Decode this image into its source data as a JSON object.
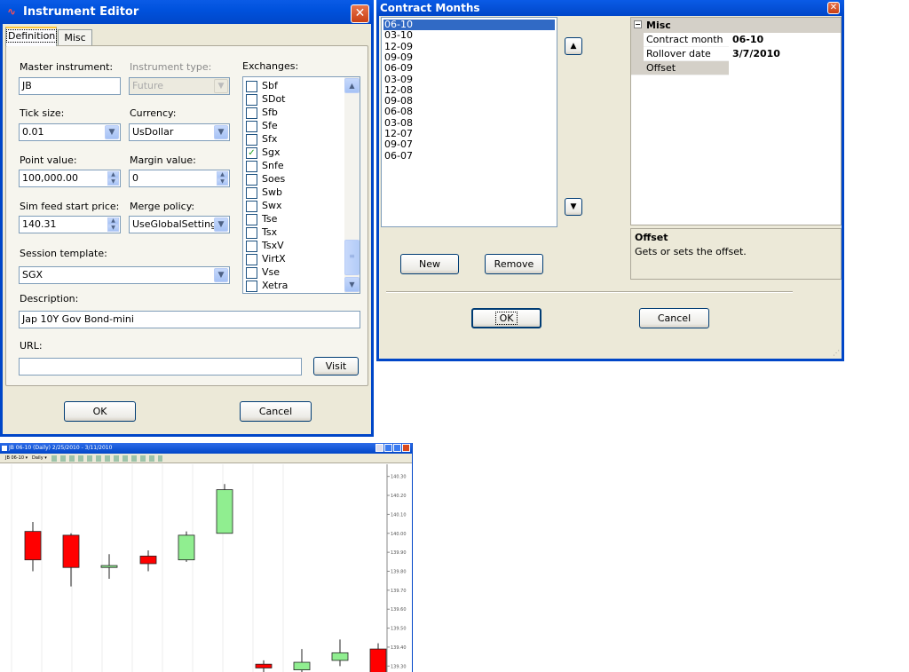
{
  "instrument_editor": {
    "title": "Instrument Editor",
    "tabs": [
      "Definition",
      "Misc"
    ],
    "master_instrument": {
      "label": "Master instrument:",
      "value": "JB"
    },
    "instrument_type": {
      "label": "Instrument type:",
      "value": "Future"
    },
    "exchanges_label": "Exchanges:",
    "tick_size": {
      "label": "Tick size:",
      "value": "0.01"
    },
    "currency": {
      "label": "Currency:",
      "value": "UsDollar"
    },
    "point_value": {
      "label": "Point value:",
      "value": "100,000.00"
    },
    "margin_value": {
      "label": "Margin value:",
      "value": "0"
    },
    "sim_feed_start_price": {
      "label": "Sim feed start price:",
      "value": "140.31"
    },
    "merge_policy": {
      "label": "Merge policy:",
      "value": "UseGlobalSettings"
    },
    "session_template": {
      "label": "Session template:",
      "value": "SGX"
    },
    "description": {
      "label": "Description:",
      "value": "Jap 10Y Gov Bond-mini"
    },
    "url": {
      "label": "URL:",
      "value": ""
    },
    "visit_label": "Visit",
    "ok_label": "OK",
    "cancel_label": "Cancel",
    "exchanges": [
      {
        "name": "Sbf",
        "checked": false
      },
      {
        "name": "SDot",
        "checked": false
      },
      {
        "name": "Sfb",
        "checked": false
      },
      {
        "name": "Sfe",
        "checked": false
      },
      {
        "name": "Sfx",
        "checked": false
      },
      {
        "name": "Sgx",
        "checked": true
      },
      {
        "name": "Snfe",
        "checked": false
      },
      {
        "name": "Soes",
        "checked": false
      },
      {
        "name": "Swb",
        "checked": false
      },
      {
        "name": "Swx",
        "checked": false
      },
      {
        "name": "Tse",
        "checked": false
      },
      {
        "name": "Tsx",
        "checked": false
      },
      {
        "name": "TsxV",
        "checked": false
      },
      {
        "name": "VirtX",
        "checked": false
      },
      {
        "name": "Vse",
        "checked": false
      },
      {
        "name": "Xetra",
        "checked": false
      }
    ]
  },
  "contract_months": {
    "title": "Contract Months",
    "months": [
      "06-10",
      "03-10",
      "12-09",
      "09-09",
      "06-09",
      "03-09",
      "12-08",
      "09-08",
      "06-08",
      "03-08",
      "12-07",
      "09-07",
      "06-07"
    ],
    "selected_index": 0,
    "grid": {
      "category": "Misc",
      "rows": [
        {
          "name": "Contract month",
          "value": "06-10"
        },
        {
          "name": "Rollover date",
          "value": "3/7/2010"
        },
        {
          "name": "Offset",
          "value": ""
        }
      ]
    },
    "help_title": "Offset",
    "help_text": "Gets or sets the offset.",
    "new_label": "New",
    "remove_label": "Remove",
    "ok_label": "OK",
    "cancel_label": "Cancel"
  },
  "chart_window": {
    "title": "JB 06-10 (Daily)  2/25/2010 - 3/11/2010",
    "toolbar": {
      "instrument": "JB 06-10",
      "period": "Daily"
    }
  },
  "chart_data": {
    "type": "candlestick",
    "ylim": [
      139.25,
      140.35
    ],
    "yticks": [
      "140.30",
      "140.20",
      "140.10",
      "140.00",
      "139.90",
      "139.80",
      "139.70",
      "139.60",
      "139.50",
      "139.40",
      "139.30"
    ],
    "candles": [
      {
        "open": 140.01,
        "high": 140.06,
        "low": 139.8,
        "close": 139.86,
        "color": "#ff0000"
      },
      {
        "open": 139.99,
        "high": 140.0,
        "low": 139.72,
        "close": 139.82,
        "color": "#ff0000"
      },
      {
        "open": 139.82,
        "high": 139.89,
        "low": 139.76,
        "close": 139.83,
        "color": "#90ee90"
      },
      {
        "open": 139.88,
        "high": 139.91,
        "low": 139.8,
        "close": 139.84,
        "color": "#ff0000"
      },
      {
        "open": 139.86,
        "high": 140.01,
        "low": 139.85,
        "close": 139.99,
        "color": "#90ee90"
      },
      {
        "open": 140.0,
        "high": 140.26,
        "low": 140.0,
        "close": 140.23,
        "color": "#90ee90"
      },
      {
        "open": 139.31,
        "high": 139.33,
        "low": 139.25,
        "close": 139.29,
        "color": "#ff0000"
      },
      {
        "open": 139.28,
        "high": 139.39,
        "low": 139.25,
        "close": 139.32,
        "color": "#90ee90"
      },
      {
        "open": 139.33,
        "high": 139.44,
        "low": 139.3,
        "close": 139.37,
        "color": "#90ee90"
      },
      {
        "open": 139.39,
        "high": 139.42,
        "low": 139.25,
        "close": 139.26,
        "color": "#ff0000"
      }
    ]
  }
}
